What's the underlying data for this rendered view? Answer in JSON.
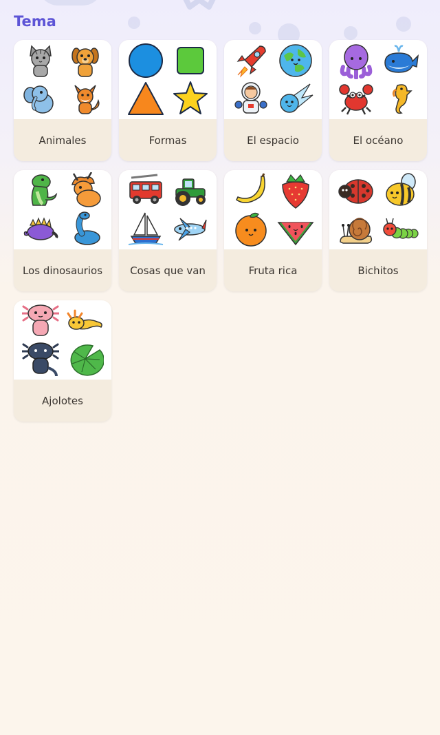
{
  "header": {
    "title": "Tema"
  },
  "colors": {
    "title": "#5d54d6",
    "card_label_bg": "#f4ecdf",
    "card_image_bg": "#ffffff",
    "label_text": "#3a3530"
  },
  "cards": [
    {
      "label": "Animales",
      "icons": [
        "cat-icon",
        "dog-icon",
        "elephant-icon",
        "fox-icon"
      ]
    },
    {
      "label": "Formas",
      "icons": [
        "circle-shape-icon",
        "square-shape-icon",
        "triangle-shape-icon",
        "star-shape-icon"
      ]
    },
    {
      "label": "El espacio",
      "icons": [
        "rocket-icon",
        "planet-earth-icon",
        "astronaut-icon",
        "comet-icon"
      ]
    },
    {
      "label": "El océano",
      "icons": [
        "octopus-icon",
        "whale-icon",
        "crab-icon",
        "seahorse-icon"
      ]
    },
    {
      "label": "Los dinosaurios",
      "icons": [
        "trex-icon",
        "triceratops-icon",
        "stegosaurus-icon",
        "brachiosaurus-icon"
      ]
    },
    {
      "label": "Cosas que van",
      "icons": [
        "fire-truck-icon",
        "tractor-icon",
        "sailboat-icon",
        "airplane-icon"
      ]
    },
    {
      "label": "Fruta rica",
      "icons": [
        "banana-icon",
        "strawberry-icon",
        "orange-icon",
        "watermelon-icon"
      ]
    },
    {
      "label": "Bichitos",
      "icons": [
        "ladybug-icon",
        "bee-icon",
        "snail-icon",
        "caterpillar-icon"
      ]
    },
    {
      "label": "Ajolotes",
      "icons": [
        "pink-axolotl-icon",
        "yellow-axolotl-icon",
        "dark-axolotl-icon",
        "lily-pad-icon"
      ]
    }
  ]
}
